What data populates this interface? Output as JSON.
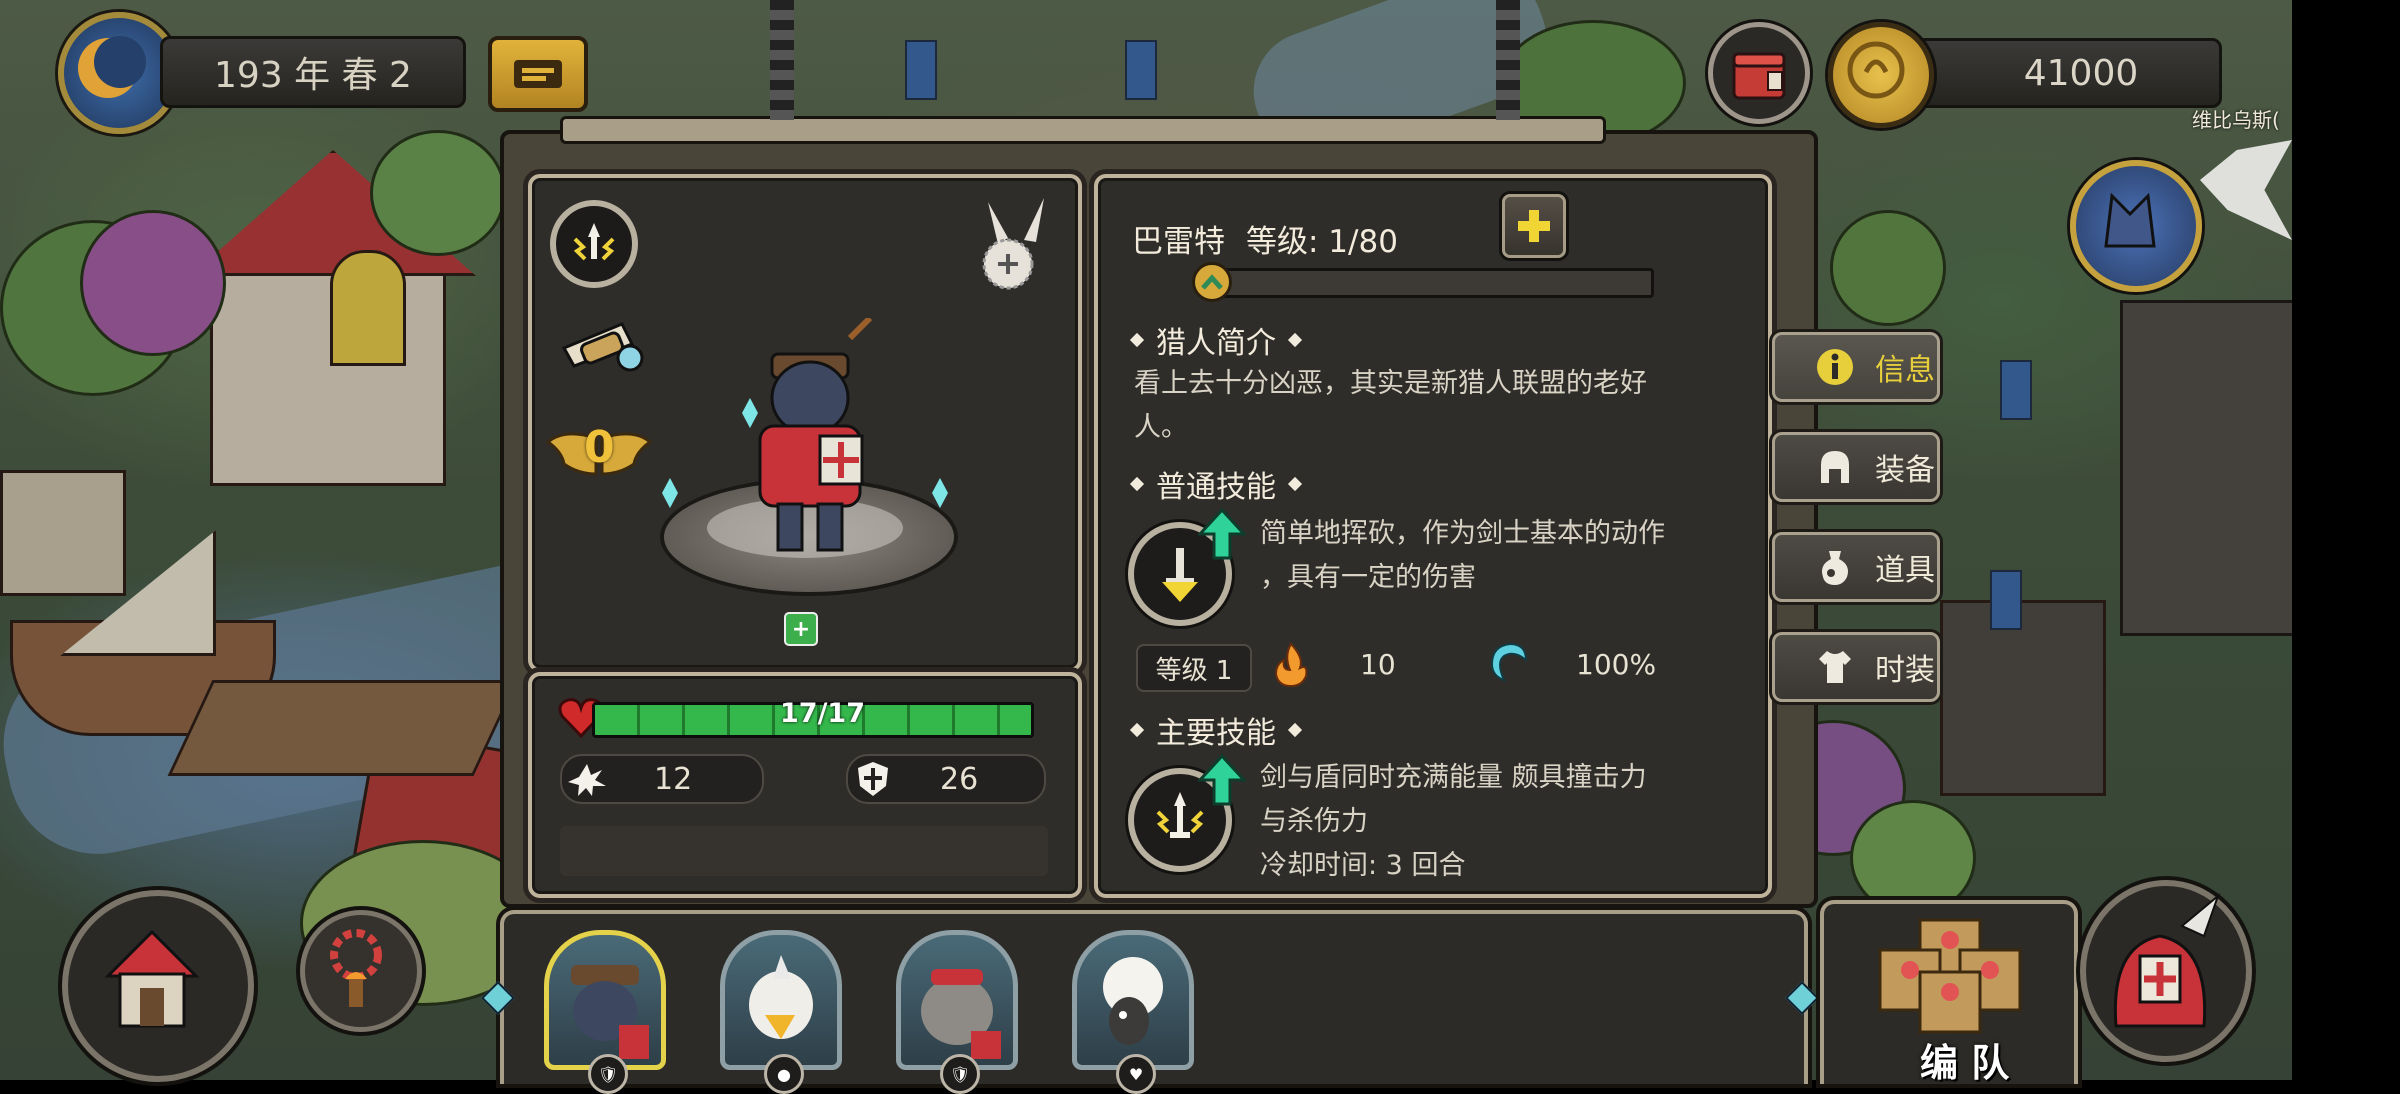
{
  "top_bar": {
    "date_text": "193 年 春 2",
    "gold_amount": "41000",
    "ally_name": "维比乌斯(",
    "colors": {
      "gold": "#d6a93a",
      "accent_yellow": "#e7cf3c"
    }
  },
  "hunter": {
    "name": "巴雷特",
    "level_label": "等级: 1/80",
    "rank_number": "0",
    "health_text": "17/17",
    "health_fraction": 1.0,
    "xp_fraction": 0.0,
    "attack_value": "12",
    "defense_value": "26",
    "colors": {
      "health_green": "#2fae46",
      "armor_red": "#c8333a",
      "skin": "#3e4760"
    }
  },
  "sections": {
    "intro_title": "猎人简介",
    "intro_text_line1": "看上去十分凶恶，其实是新猎人联盟的老好",
    "intro_text_line2": "人。",
    "normal_skill_title": "普通技能",
    "normal_skill_line1": "简单地挥砍，作为剑士基本的动作",
    "normal_skill_line2": "，具有一定的伤害",
    "normal_skill_level": "等级 1",
    "normal_skill_power": "10",
    "normal_skill_accuracy": "100%",
    "main_skill_title": "主要技能",
    "main_skill_line1": "剑与盾同时充满能量 颇具撞击力",
    "main_skill_line2": "与杀伤力",
    "main_skill_line3": "冷却时间: 3 回合"
  },
  "tabs": [
    {
      "label": "信息",
      "icon": "info-icon",
      "active": true
    },
    {
      "label": "装备",
      "icon": "helmet-icon",
      "active": false
    },
    {
      "label": "道具",
      "icon": "potion-bag-icon",
      "active": false
    },
    {
      "label": "时装",
      "icon": "shirt-icon",
      "active": false
    }
  ],
  "roster": [
    {
      "name": "boar-swordsman",
      "badge_icon": "shield-icon",
      "selected": true
    },
    {
      "name": "eagle-hunter",
      "badge_icon": "paw-icon",
      "selected": false
    },
    {
      "name": "elephant-hunter",
      "badge_icon": "shield-icon",
      "selected": false
    },
    {
      "name": "alpaca-hunter",
      "badge_icon": "heart-icon",
      "selected": false
    }
  ],
  "team_button_label": "编 队"
}
